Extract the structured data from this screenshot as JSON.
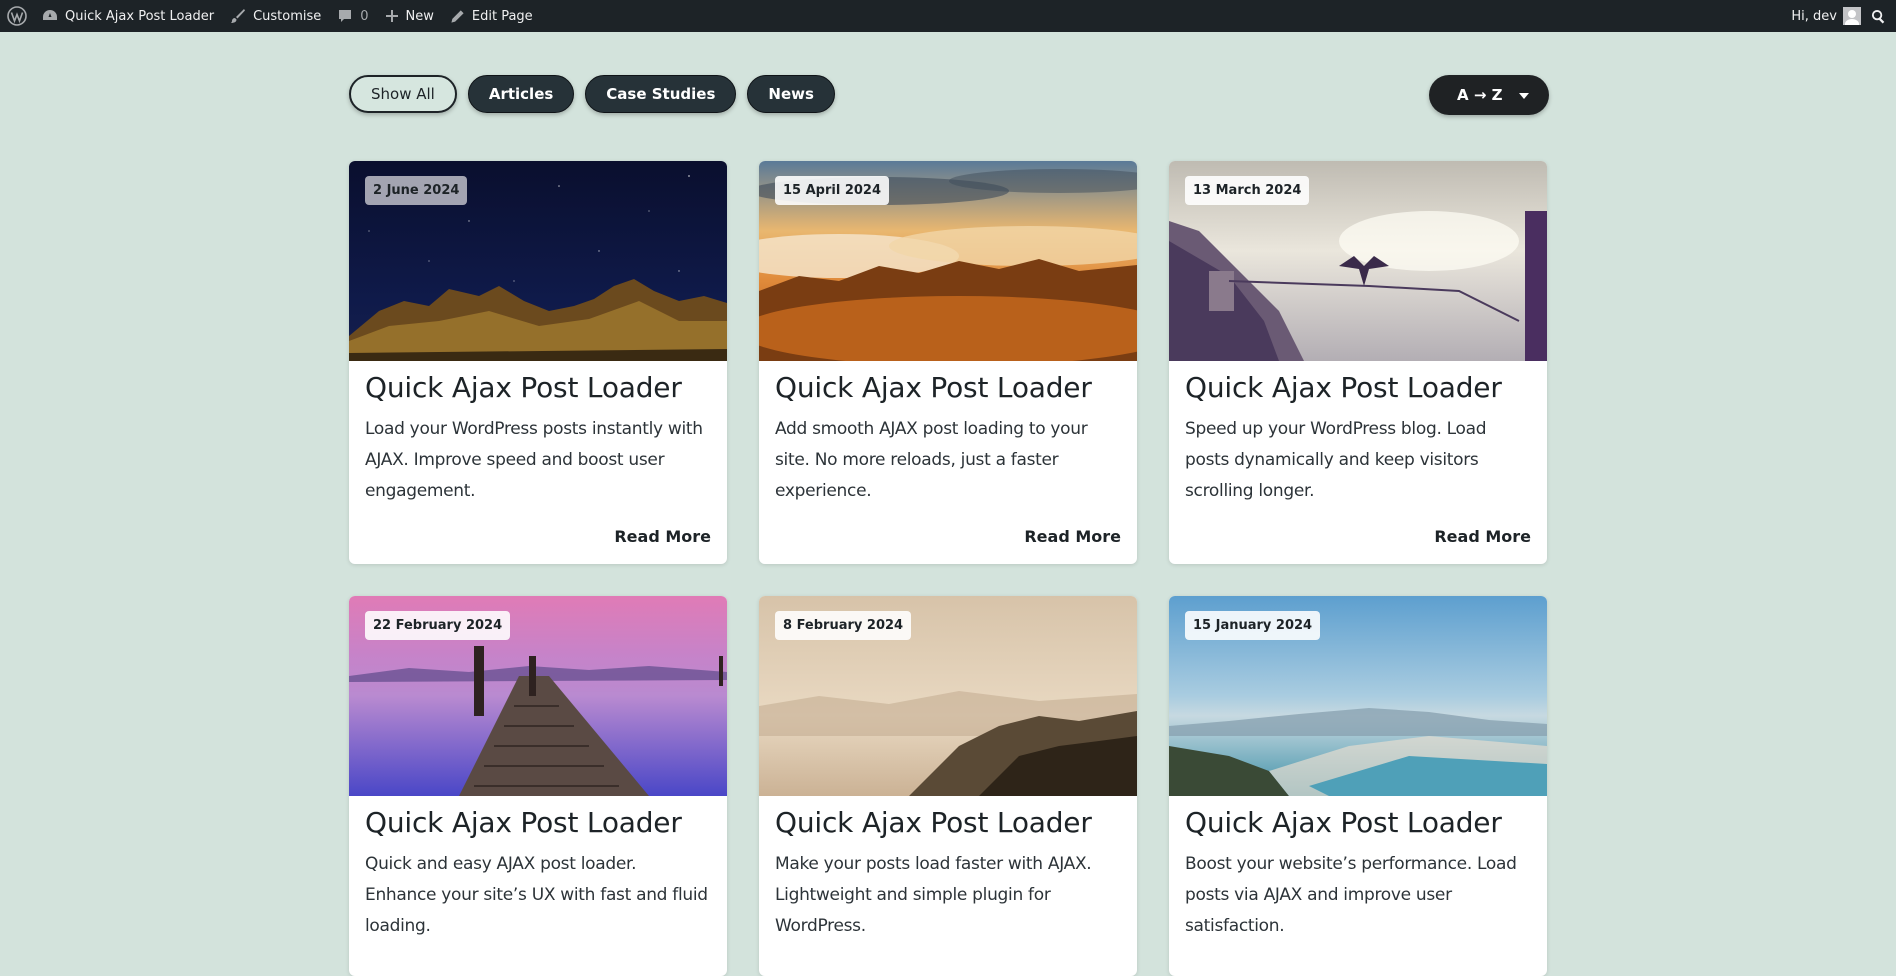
{
  "adminbar": {
    "site_name": "Quick Ajax Post Loader",
    "customise": "Customise",
    "comments_count": "0",
    "new_label": "New",
    "edit_label": "Edit Page",
    "greeting": "Hi, dev"
  },
  "filters": {
    "buttons": [
      "Show All",
      "Articles",
      "Case Studies",
      "News"
    ],
    "active": "Show All"
  },
  "sort": {
    "label": "A → Z"
  },
  "posts": [
    {
      "date": "2 June 2024",
      "title": "Quick Ajax Post Loader",
      "excerpt": "Load your WordPress posts instantly with AJAX. Improve speed and boost user engagement.",
      "read_more": "Read More",
      "image": "night-sky-mountains"
    },
    {
      "date": "15 April 2024",
      "title": "Quick Ajax Post Loader",
      "excerpt": "Add smooth AJAX post loading to your site. No more reloads, just a faster experience.",
      "read_more": "Read More",
      "image": "sunset-over-clouds"
    },
    {
      "date": "13 March 2024",
      "title": "Quick Ajax Post Loader",
      "excerpt": "Speed up your WordPress blog. Load posts dynamically and keep visitors scrolling longer.",
      "read_more": "Read More",
      "image": "boat-with-bird"
    },
    {
      "date": "22 February 2024",
      "title": "Quick Ajax Post Loader",
      "excerpt": "Quick and easy AJAX post loader. Enhance your site’s UX with fast and fluid loading.",
      "read_more": "",
      "image": "pier-at-dusk"
    },
    {
      "date": "8 February 2024",
      "title": "Quick Ajax Post Loader",
      "excerpt": "Make your posts load faster with AJAX. Lightweight and simple plugin for WordPress.",
      "read_more": "",
      "image": "misty-hills"
    },
    {
      "date": "15 January 2024",
      "title": "Quick Ajax Post Loader",
      "excerpt": "Boost your website’s performance. Load posts via AJAX and improve user satisfaction.",
      "read_more": "",
      "image": "coastline"
    }
  ],
  "colors": {
    "page_bg": "#d3e3dc",
    "adminbar_bg": "#1d2327",
    "chip_bg": "#263238",
    "sort_bg": "#1f2224"
  }
}
